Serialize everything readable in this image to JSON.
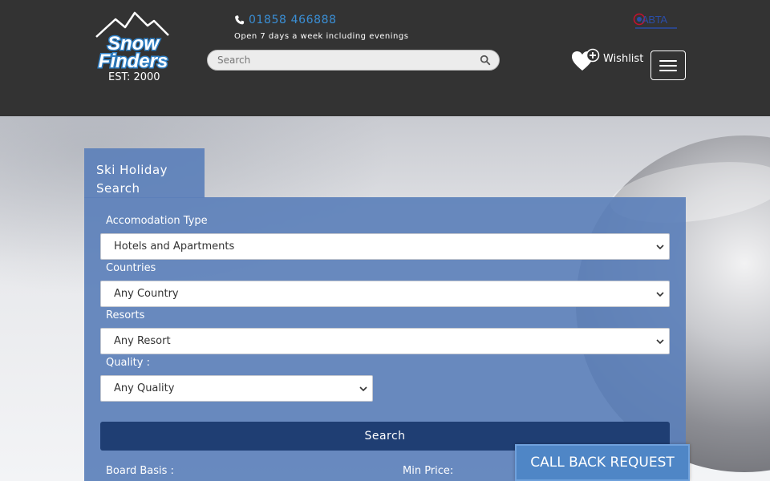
{
  "brand": {
    "logo_line1": "Snow",
    "logo_line2": "Finders",
    "established": "EST: 2000"
  },
  "contact": {
    "phone_icon": "phone-icon",
    "phone": "01858 466888",
    "hours": "Open 7 days a week including evenings"
  },
  "search": {
    "placeholder": "Search",
    "icon": "search-icon"
  },
  "abta": {
    "text": "ABTA"
  },
  "wishlist": {
    "label": "Wishlist",
    "icon": "heart-plus-icon"
  },
  "menu": {
    "icon": "hamburger-menu-icon"
  },
  "form": {
    "tab_title": "Ski Holiday Search",
    "accommodation": {
      "label": "Accomodation Type",
      "value": "Hotels and Apartments"
    },
    "countries": {
      "label": "Countries",
      "value": "Any Country"
    },
    "resorts": {
      "label": "Resorts",
      "value": "Any Resort"
    },
    "quality": {
      "label": "Quality :",
      "value": "Any Quality"
    },
    "search_button": "Search",
    "board_basis_label": "Board Basis :",
    "min_price_label": "Min Price:"
  },
  "callback": {
    "label": "CALL BACK REQUEST"
  },
  "colors": {
    "header_bg": "#333333",
    "panel_bg": "#5c80ba",
    "accent_phone": "#3a8fd6",
    "button_dark": "#1f3e73",
    "callback_bg": "#4f86c6"
  }
}
